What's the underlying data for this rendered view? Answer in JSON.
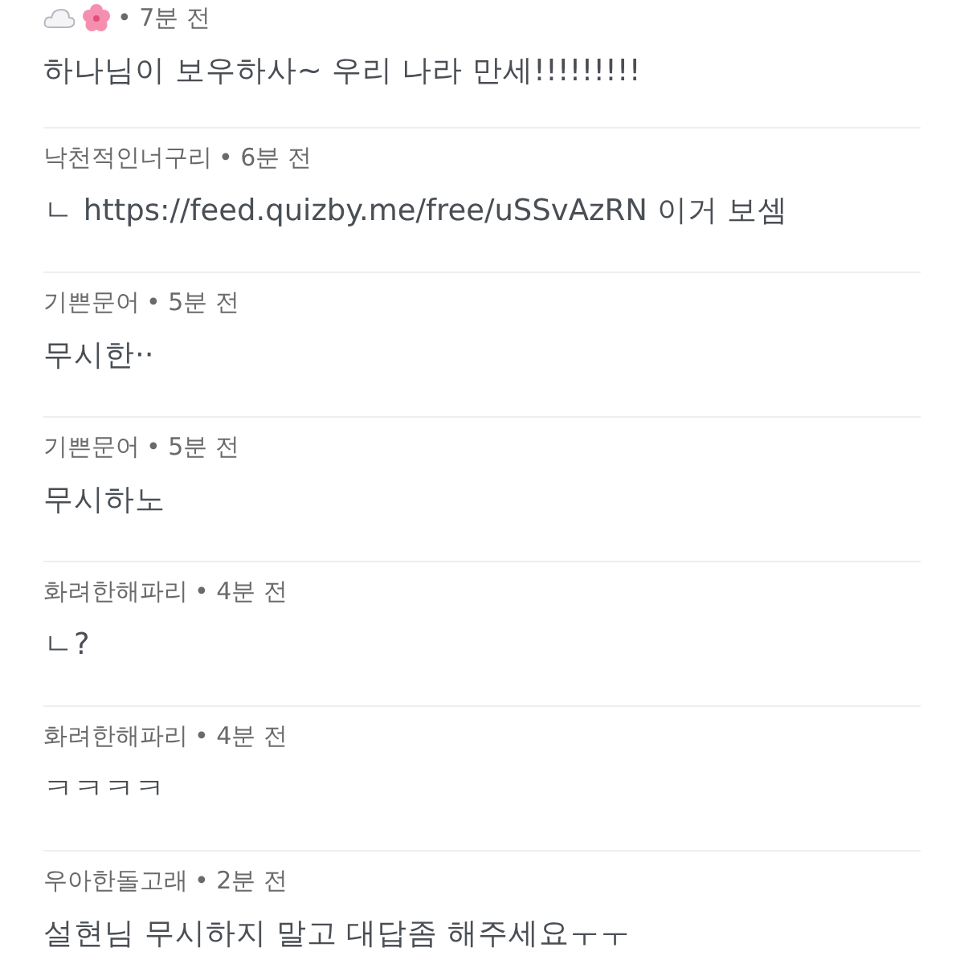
{
  "comments": [
    {
      "kind": "emoji-author",
      "time": "• 7분 전",
      "text": "하나님이 보우하사~ 우리 나라 만세!!!!!!!!!"
    },
    {
      "kind": "named",
      "author": "낙천적인너구리",
      "time": "• 6분 전",
      "text": "ㄴ https://feed.quizby.me/free/uSSvAzRN 이거 보셈"
    },
    {
      "kind": "named",
      "author": "기쁜문어",
      "time": "• 5분 전",
      "text": "무시한··"
    },
    {
      "kind": "named",
      "author": "기쁜문어",
      "time": "• 5분 전",
      "text": "무시하노"
    },
    {
      "kind": "named",
      "author": "화려한해파리",
      "time": "• 4분 전",
      "text": "ㄴ?"
    },
    {
      "kind": "named",
      "author": "화려한해파리",
      "time": "• 4분 전",
      "text": "ㅋㅋㅋㅋ"
    },
    {
      "kind": "named",
      "author": "우아한돌고래",
      "time": "• 2분 전",
      "text": "설현님 무시하지 말고 대답좀 해주세요ㅜㅜ"
    }
  ]
}
